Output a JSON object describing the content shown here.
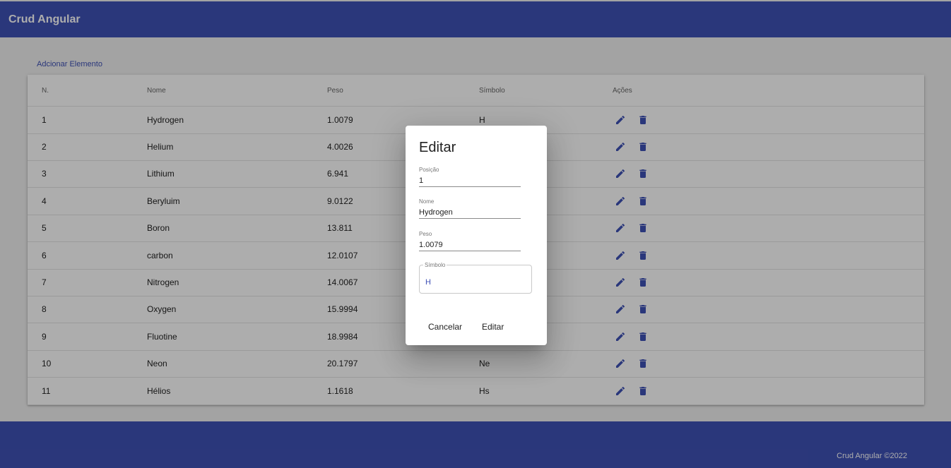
{
  "app": {
    "title": "Crud Angular"
  },
  "add_link": "Adcionar Elemento",
  "table": {
    "headers": {
      "num": "N.",
      "name": "Nome",
      "peso": "Peso",
      "symbol": "Símbolo",
      "actions": "Ações"
    },
    "rows": [
      {
        "num": "1",
        "name": "Hydrogen",
        "peso": "1.0079",
        "symbol": "H"
      },
      {
        "num": "2",
        "name": "Helium",
        "peso": "4.0026",
        "symbol": ""
      },
      {
        "num": "3",
        "name": "Lithium",
        "peso": "6.941",
        "symbol": ""
      },
      {
        "num": "4",
        "name": "Beryluim",
        "peso": "9.0122",
        "symbol": ""
      },
      {
        "num": "5",
        "name": "Boron",
        "peso": "13.811",
        "symbol": ""
      },
      {
        "num": "6",
        "name": "carbon",
        "peso": "12.0107",
        "symbol": ""
      },
      {
        "num": "7",
        "name": "Nitrogen",
        "peso": "14.0067",
        "symbol": ""
      },
      {
        "num": "8",
        "name": "Oxygen",
        "peso": "15.9994",
        "symbol": ""
      },
      {
        "num": "9",
        "name": "Fluotine",
        "peso": "18.9984",
        "symbol": ""
      },
      {
        "num": "10",
        "name": "Neon",
        "peso": "20.1797",
        "symbol": "Ne"
      },
      {
        "num": "11",
        "name": "Hélios",
        "peso": "1.1618",
        "symbol": "Hs"
      }
    ],
    "action_icons": [
      "pencil-icon",
      "trash-icon"
    ]
  },
  "dialog": {
    "title": "Editar",
    "fields": {
      "posicao": {
        "label": "Posição",
        "value": "1"
      },
      "nome": {
        "label": "Nome",
        "value": "Hydrogen"
      },
      "peso": {
        "label": "Peso",
        "value": "1.0079"
      },
      "simbolo": {
        "label": "Símbolo",
        "value": "H"
      }
    },
    "cancel_label": "Cancelar",
    "confirm_label": "Editar"
  },
  "footer": {
    "text": "Crud Angular ©2022"
  },
  "colors": {
    "primary": "#3f51b5",
    "icon": "#3f51b5"
  }
}
